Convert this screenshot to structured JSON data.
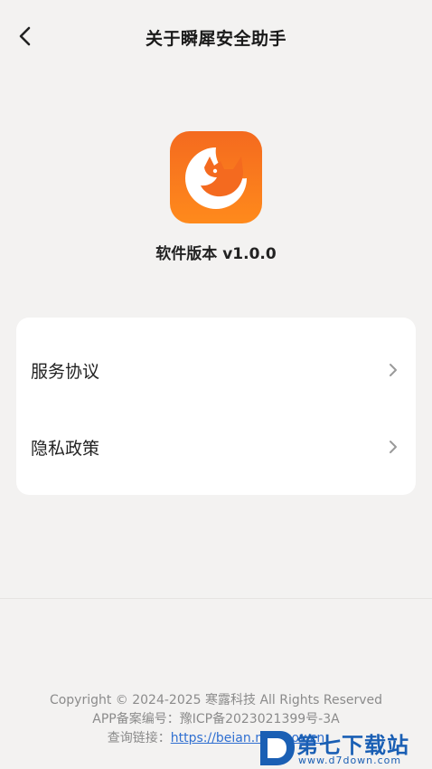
{
  "header": {
    "title": "关于瞬犀安全助手",
    "back_icon": "chevron-left-icon"
  },
  "app": {
    "icon": "rhino-logo",
    "icon_color_top": "#f46a1f",
    "icon_color_bottom": "#ff8a1c",
    "version_label": "软件版本 v1.0.0"
  },
  "menu": {
    "items": [
      {
        "label": "服务协议",
        "icon": "chevron-right-icon"
      },
      {
        "label": "隐私政策",
        "icon": "chevron-right-icon"
      }
    ]
  },
  "footer": {
    "copyright": "Copyright © 2024-2025 寒露科技 All Rights Reserved",
    "record": "APP备案编号：豫ICP备2023021399号-3A",
    "query_prefix": "查询链接：",
    "query_link": "https://beian.miit.gov.cn"
  },
  "watermark": {
    "text": "第七下载站",
    "url": "www.d7down.com",
    "color": "#1a5fb4"
  }
}
